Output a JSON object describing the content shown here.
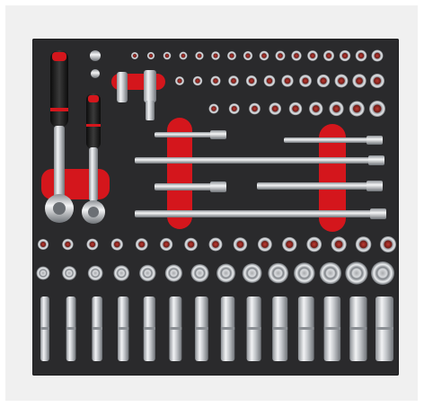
{
  "image": {
    "subject": "tool-tray",
    "colors": {
      "background": "#ffffff",
      "frame": "#f0f0f0",
      "foam": "#2a2a2c",
      "accent_red": "#d4161c",
      "chrome": "#c9ccd0"
    }
  }
}
